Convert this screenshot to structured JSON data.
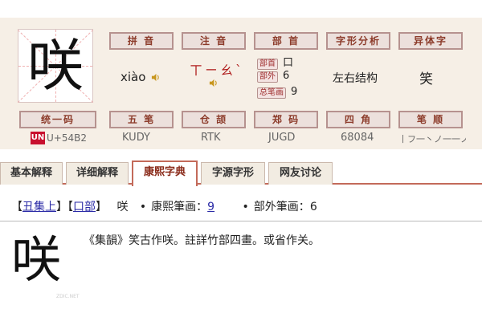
{
  "character": "咲",
  "info": {
    "labels": {
      "pinyin": "拼 音",
      "zhuyin": "注 音",
      "radical": "部 首",
      "structure": "字形分析",
      "variant": "异体字",
      "unicode": "统一码",
      "wubi": "五 笔",
      "cangjie": "仓 颉",
      "zhengma": "郑 码",
      "sijiao": "四 角",
      "stroke_order": "笔 顺"
    },
    "pinyin": "xiào",
    "zhuyin": "ㄒㄧㄠˋ",
    "radical_rows": [
      {
        "tag": "部首",
        "value": "口"
      },
      {
        "tag": "部外",
        "value": "6"
      },
      {
        "tag": "总笔画",
        "value": "9"
      }
    ],
    "structure": "左右结构",
    "variant": "笑",
    "unicode": "U+54B2",
    "wubi": "KUDY",
    "cangjie": "RTK",
    "zhengma": "JUGD",
    "sijiao": "68084",
    "stroke_order": "丨フ一丶ノ一一ノ丶",
    "unicode_badge": "UN"
  },
  "tabs": [
    {
      "label": "基本解释"
    },
    {
      "label": "详细解释"
    },
    {
      "label": "康熙字典",
      "active": true
    },
    {
      "label": "字源字形"
    },
    {
      "label": "网友讨论"
    }
  ],
  "kangxi": {
    "open1": "【",
    "volume": "丑集上",
    "close1": "】",
    "open2": "【",
    "radical": "口部",
    "close2": "】",
    "char": "咲",
    "stroke_label": "康熙筆画：",
    "stroke_count": "9",
    "outside_label": "部外筆画：",
    "outside_count": "6",
    "text": "《集韻》笑古作咲。註詳竹部四畫。或省作关。",
    "watermark": "ZDIC.NET"
  }
}
